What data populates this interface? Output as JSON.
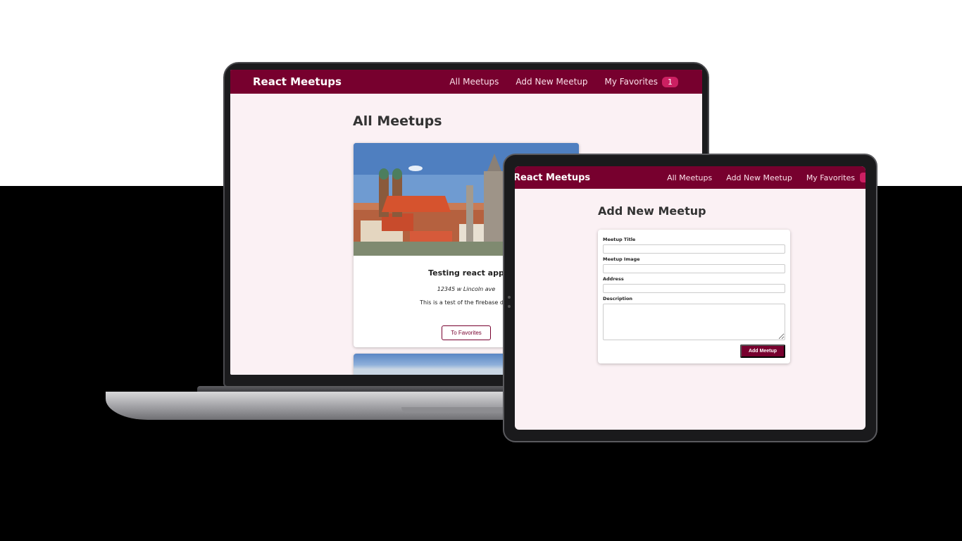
{
  "laptop": {
    "header": {
      "brand": "React Meetups",
      "nav": [
        {
          "label": "All Meetups"
        },
        {
          "label": "Add New Meetup"
        },
        {
          "label": "My Favorites"
        }
      ],
      "favorites_count": "1"
    },
    "page_title": "All Meetups",
    "meetups": [
      {
        "title": "Testing react app",
        "address": "12345 w Lincoln ave",
        "description": "This is a test of the firebase data",
        "button_label": "To Favorites"
      }
    ]
  },
  "tablet": {
    "header": {
      "brand": "React Meetups",
      "nav": [
        {
          "label": "All Meetups"
        },
        {
          "label": "Add New Meetup"
        },
        {
          "label": "My Favorites"
        }
      ]
    },
    "page_title": "Add New Meetup",
    "form": {
      "title_label": "Meetup Title",
      "image_label": "Meetup Image",
      "address_label": "Address",
      "description_label": "Description",
      "submit_label": "Add Meetup"
    }
  },
  "colors": {
    "brand": "#77002e",
    "badge": "#cc2062",
    "page_bg": "#fbf1f4"
  }
}
